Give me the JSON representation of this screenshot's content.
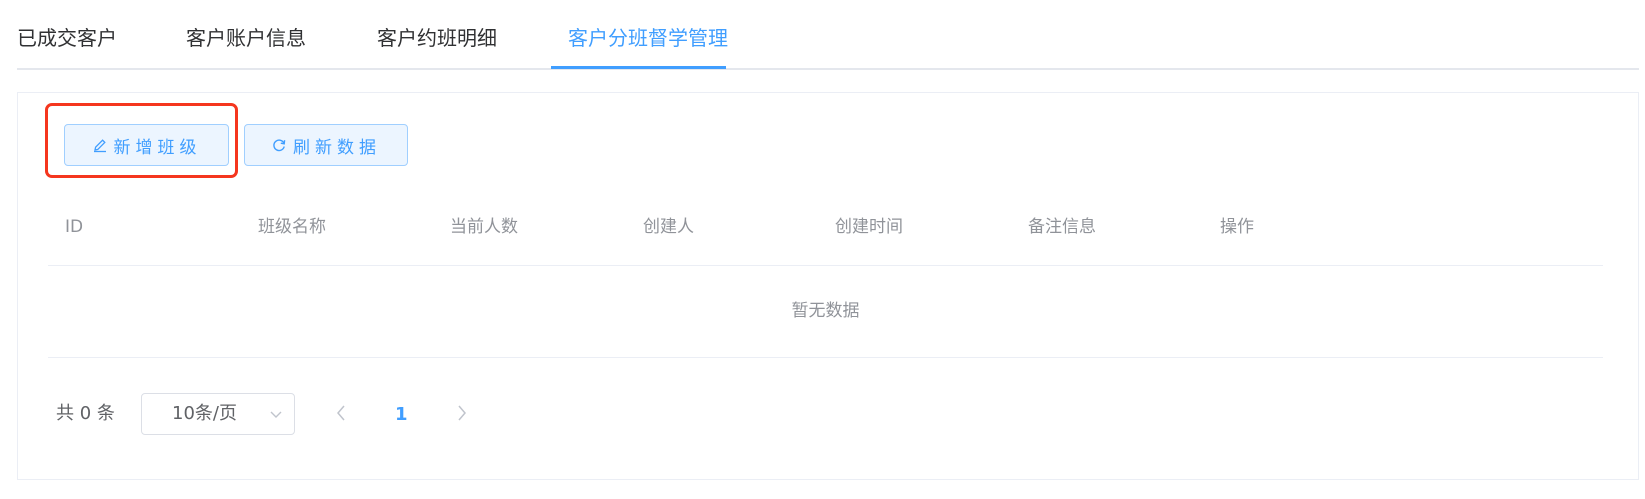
{
  "tabs": [
    {
      "label": "已成交客户"
    },
    {
      "label": "客户账户信息"
    },
    {
      "label": "客户约班明细"
    },
    {
      "label": "客户分班督学管理"
    }
  ],
  "active_tab": "客户分班督学管理",
  "toolbar": {
    "add_label": "新增班级",
    "add_icon": "edit-icon",
    "refresh_label": "刷新数据",
    "refresh_icon": "refresh-icon"
  },
  "table": {
    "columns": [
      "ID",
      "班级名称",
      "当前人数",
      "创建人",
      "创建时间",
      "备注信息",
      "操作"
    ],
    "rows": [],
    "empty_text": "暂无数据"
  },
  "pagination": {
    "total_text": "共 0 条",
    "page_size": "10条/页",
    "current_page": "1"
  },
  "colors": {
    "accent": "#409eff",
    "highlight": "#f5361e"
  }
}
